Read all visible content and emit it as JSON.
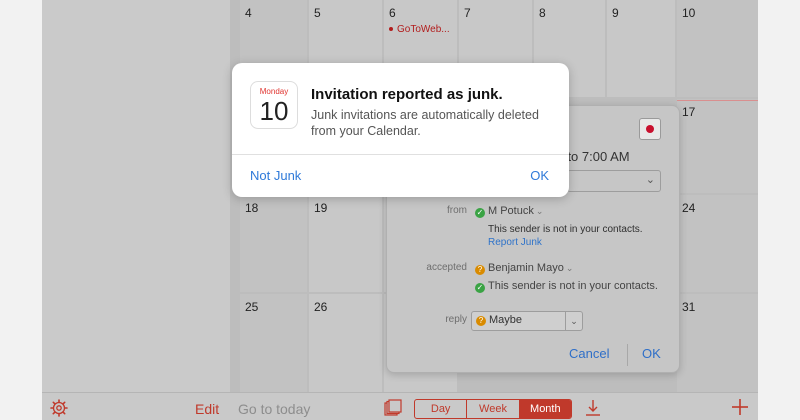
{
  "calendar": {
    "days": [
      "4",
      "5",
      "6",
      "7",
      "8",
      "9",
      "10",
      "17",
      "18",
      "19",
      "24",
      "25",
      "26",
      "31"
    ],
    "event": "GoToWeb..."
  },
  "popover": {
    "time_partial": "M to 7:00 AM",
    "from_label": "from",
    "from_name": "M Potuck",
    "from_note": "This sender is not in your contacts.",
    "report_junk": "Report Junk",
    "accepted_label": "accepted",
    "accepted_name": "Benjamin Mayo",
    "accepted_note": "This sender is not in your contacts.",
    "reply_label": "reply",
    "reply_value": "Maybe",
    "cancel": "Cancel",
    "ok": "OK"
  },
  "alert": {
    "icon_weekday": "Monday",
    "icon_day": "10",
    "title": "Invitation reported as junk.",
    "message": "Junk invitations are automatically deleted from your Calendar.",
    "not_junk": "Not Junk",
    "ok": "OK"
  },
  "toolbar": {
    "edit": "Edit",
    "go_to_today": "Go to today",
    "views": [
      "Day",
      "Week",
      "Month"
    ],
    "selected_view": "Month"
  },
  "colors": {
    "accent": "#c0392b",
    "link": "#2f7ad9",
    "calendar_dot": "#c8102e"
  },
  "icons": [
    "gear-icon",
    "inbox-icon",
    "download-icon",
    "plus-icon",
    "calendar-app-icon"
  ]
}
